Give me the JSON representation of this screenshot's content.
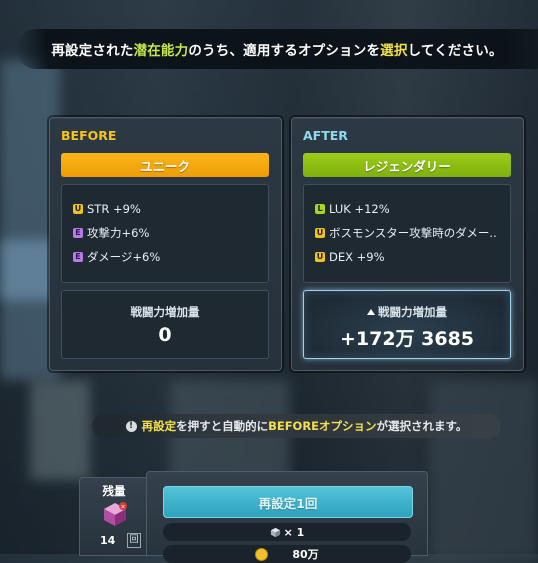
{
  "banner": {
    "part1": "再設定された",
    "highlight1": "潜在能力",
    "part2": "のうち、適用するオプションを",
    "highlight2": "選択",
    "part3": "してください。"
  },
  "before": {
    "label": "BEFORE",
    "grade": "ユニーク",
    "options": [
      {
        "badge": "U",
        "text": "STR +9%"
      },
      {
        "badge": "E",
        "text": "攻撃力+6%"
      },
      {
        "badge": "E",
        "text": "ダメージ+6%"
      }
    ],
    "power_title": "戦闘力増加量",
    "power_value": "0"
  },
  "after": {
    "label": "AFTER",
    "grade": "レジェンダリー",
    "options": [
      {
        "badge": "L",
        "text": "LUK +12%"
      },
      {
        "badge": "U",
        "text": "ボスモンスター攻撃時のダメー.."
      },
      {
        "badge": "U",
        "text": "DEX +9%"
      }
    ],
    "power_title": "戦闘力増加量",
    "power_value": "+172万 3685"
  },
  "notice": {
    "part1": "再設定",
    "part2": "を押すと自動的に",
    "part3": "BEFOREオプション",
    "part4": "が選択されます。"
  },
  "stock": {
    "label": "残量",
    "count": "14",
    "unit": "回"
  },
  "action": {
    "reset_button": "再設定1回",
    "cube_cost": "× 1",
    "meso_cost": "80万"
  },
  "colors": {
    "unique": "#f9b619",
    "legendary": "#9dcc1a",
    "accent_button": "#3fb4cc"
  }
}
